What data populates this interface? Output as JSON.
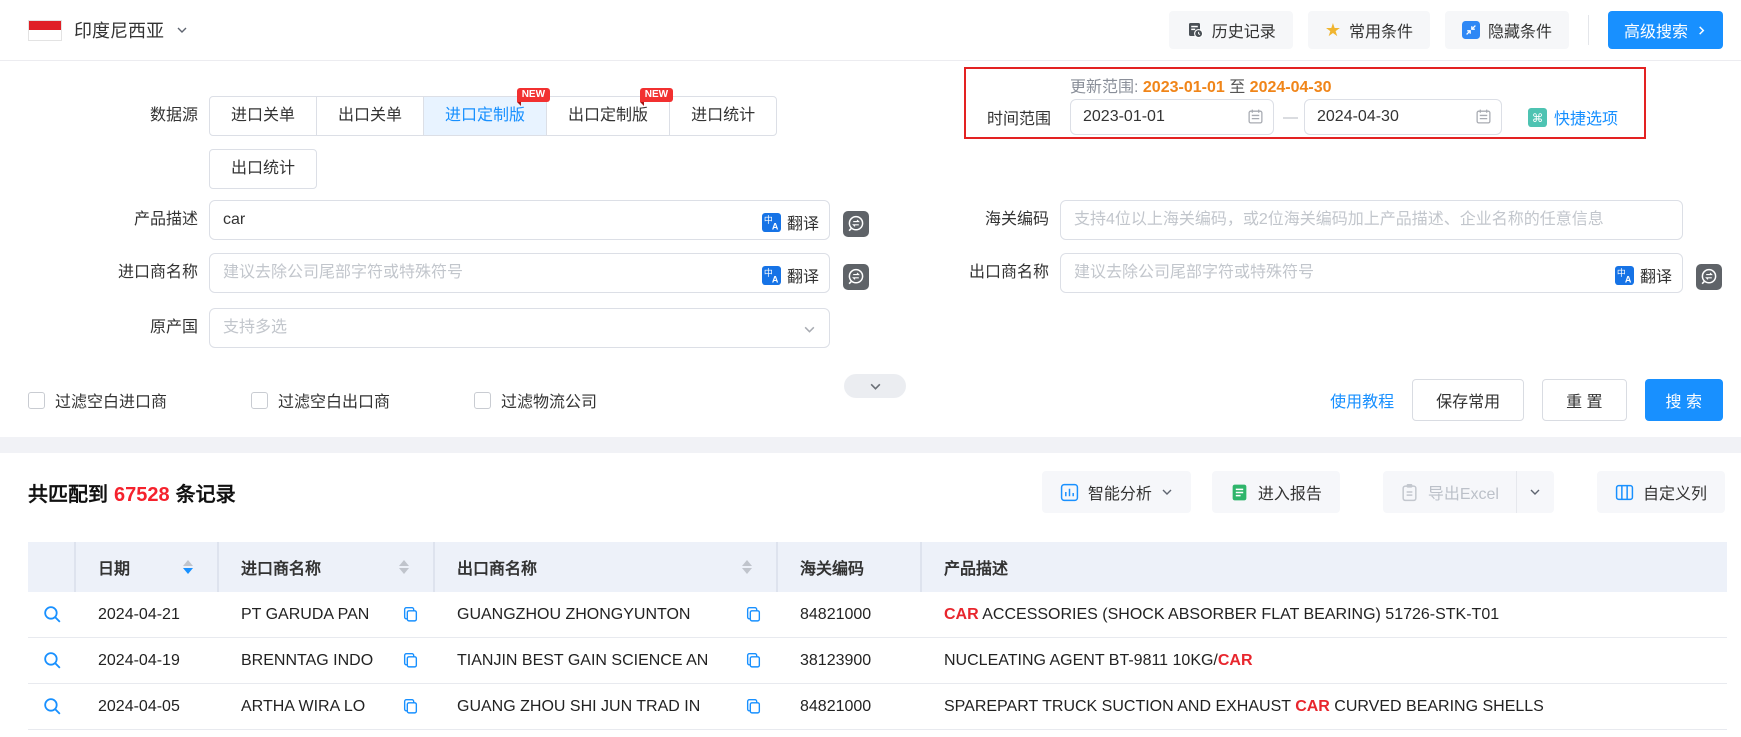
{
  "topbar": {
    "country": "印度尼西亚",
    "history_btn": "历史记录",
    "favorites_btn": "常用条件",
    "hide_btn": "隐藏条件",
    "advanced_btn": "高级搜索"
  },
  "form": {
    "datasource_label": "数据源",
    "tabs": [
      {
        "label": "进口关单"
      },
      {
        "label": "出口关单"
      },
      {
        "label": "进口定制版",
        "badge": "NEW",
        "selected": true
      },
      {
        "label": "出口定制版",
        "badge": "NEW"
      },
      {
        "label": "进口统计"
      },
      {
        "label": "出口统计"
      }
    ],
    "update_range": {
      "label": "更新范围:",
      "from": "2023-01-01",
      "to_word": "至",
      "to": "2024-04-30"
    },
    "time_range": {
      "label": "时间范围",
      "from": "2023-01-01",
      "separator": "—",
      "to": "2024-04-30",
      "quick_label": "快捷选项"
    },
    "product": {
      "label": "产品描述",
      "value": "car",
      "translate": "翻译"
    },
    "hscode": {
      "label": "海关编码",
      "placeholder": "支持4位以上海关编码，或2位海关编码加上产品描述、企业名称的任意信息"
    },
    "importer": {
      "label": "进口商名称",
      "placeholder": "建议去除公司尾部字符或特殊符号",
      "translate": "翻译"
    },
    "exporter": {
      "label": "出口商名称",
      "placeholder": "建议去除公司尾部字符或特殊符号",
      "translate": "翻译"
    },
    "origin": {
      "label": "原产国",
      "placeholder": "支持多选"
    },
    "filters": [
      {
        "label": "过滤空白进口商"
      },
      {
        "label": "过滤空白出口商"
      },
      {
        "label": "过滤物流公司"
      }
    ],
    "actions": {
      "tutorial": "使用教程",
      "save": "保存常用",
      "reset": "重 置",
      "search": "搜 索"
    }
  },
  "results": {
    "match_prefix": "共匹配到",
    "match_count": "67528",
    "match_suffix": "条记录",
    "toolbar": {
      "analyze": "智能分析",
      "report": "进入报告",
      "export": "导出Excel",
      "columns": "自定义列"
    },
    "table": {
      "headers": [
        "日期",
        "进口商名称",
        "出口商名称",
        "海关编码",
        "产品描述"
      ],
      "rows": [
        {
          "date": "2024-04-21",
          "importer": "PT GARUDA PAN",
          "exporter": "GUANGZHOU ZHONGYUNTON",
          "hscode": "84821000",
          "desc_pre": "",
          "desc_hl": "CAR",
          "desc_post": " ACCESSORIES (SHOCK ABSORBER FLAT BEARING) 51726-STK-T01"
        },
        {
          "date": "2024-04-19",
          "importer": "BRENNTAG INDO",
          "exporter": "TIANJIN BEST GAIN SCIENCE AN",
          "hscode": "38123900",
          "desc_pre": "NUCLEATING AGENT BT-9811 10KG/",
          "desc_hl": "CAR",
          "desc_post": ""
        },
        {
          "date": "2024-04-05",
          "importer": "ARTHA WIRA LO",
          "exporter": "GUANG ZHOU SHI JUN TRAD IN",
          "hscode": "84821000",
          "desc_pre": "SPAREPART TRUCK SUCTION AND EXHAUST ",
          "desc_hl": "CAR",
          "desc_post": " CURVED BEARING SHELLS"
        }
      ]
    }
  },
  "colors": {
    "accent": "#1890ff",
    "highlight_red": "#f5222d",
    "orange": "#f08519",
    "badge_red": "#f23030",
    "update_box_border": "#e32222"
  }
}
